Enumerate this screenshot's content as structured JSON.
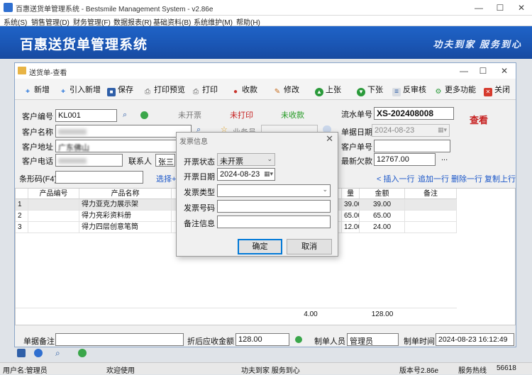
{
  "app": {
    "window_title": "百惠送货单管理系统 - Bestsmile Management System - v2.86e",
    "menu": [
      "系统(S)",
      "销售管理(D)",
      "财务管理(F)",
      "数据报表(R)",
      "基础资料(B)",
      "系统维护(M)",
      "帮助(H)"
    ],
    "banner_title": "百惠送货单管理系统",
    "banner_slogan": "功夫到家 服务到心"
  },
  "child": {
    "title": "送货单-查看",
    "toolbar": {
      "new": "新增",
      "import_new": "引入新增",
      "save": "保存",
      "print_preview": "打印预览",
      "print": "打印",
      "receive": "收款",
      "edit": "修改",
      "prev": "上张",
      "next": "下张",
      "unaudit": "反审核",
      "more": "更多功能",
      "close": "关闭"
    },
    "form": {
      "customer_code_label": "客户编号",
      "customer_code": "KL001",
      "status_invoice": "未开票",
      "status_print": "未打印",
      "status_paid": "未收款",
      "serial_label": "流水单号",
      "serial_no": "XS-202408008",
      "view_mode": "查看",
      "customer_name_label": "客户名称",
      "salesman_label": "业务员",
      "doc_date_label": "单据日期",
      "doc_date": "2024-08-23",
      "customer_addr_label": "客户地址",
      "customer_addr": "广东佛山",
      "customer_no_label": "客户单号",
      "customer_tel_label": "客户电话",
      "contact_label": "联系人",
      "contact": "张三",
      "arrears_label": "最新欠款",
      "arrears": "12767.00",
      "barcode_label": "条形码(F4)",
      "select_label": "选择+",
      "row_actions": [
        "< 插入一行",
        "追加一行",
        "删除一行",
        "复制上行"
      ]
    },
    "grid": {
      "headers": [
        "",
        "产品编号",
        "产品名称",
        "",
        "量",
        "金额",
        "备注"
      ],
      "rows": [
        {
          "no": "1",
          "code": "",
          "name": "得力亚克力展示架",
          "qty": "39.00",
          "amount": "39.00"
        },
        {
          "no": "2",
          "code": "",
          "name": "得力亮彩资料册",
          "qty": "65.00",
          "amount": "65.00"
        },
        {
          "no": "3",
          "code": "",
          "name": "得力四层创意笔筒",
          "qty": "12.00",
          "amount": "24.00"
        }
      ],
      "total_qty": "4.00",
      "total_amount": "128.00"
    },
    "footer": {
      "remark_label": "单据备注",
      "receivable_label": "折后应收金额",
      "receivable": "128.00",
      "maker_label": "制单人员",
      "maker": "管理员",
      "make_time_label": "制单时间",
      "make_time": "2024-08-23 16:12:49"
    }
  },
  "dialog": {
    "title": "发票信息",
    "invoice_status_label": "开票状态",
    "invoice_status": "未开票",
    "invoice_date_label": "开票日期",
    "invoice_date": "2024-08-23",
    "invoice_type_label": "发票类型",
    "invoice_no_label": "发票号码",
    "remark_label": "备注信息",
    "ok": "确定",
    "cancel": "取消"
  },
  "statusbar": {
    "user": "用户名:管理员",
    "welcome": "欢迎使用",
    "slogan": "功夫到家 服务到心",
    "version": "版本号2.86e",
    "service": "服务热线",
    "code": "56618"
  }
}
